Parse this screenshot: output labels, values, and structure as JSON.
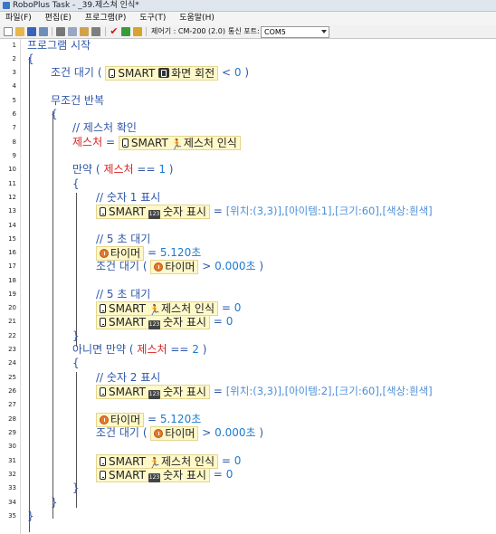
{
  "window": {
    "title": "RoboPlus Task - _39.제스쳐 인식*"
  },
  "menu": [
    "파일(F)",
    "편집(E)",
    "프로그램(P)",
    "도구(T)",
    "도움말(H)"
  ],
  "toolbar": {
    "controller_label": "제어기 : CM-200 (2.0)",
    "port_label": "통신 포트:",
    "port_value": "COM5"
  },
  "lines": [
    {
      "n": "1",
      "kw": "프로그램 시작"
    },
    {
      "n": "2",
      "kw": "{"
    },
    {
      "n": "3",
      "a": "조건 대기",
      "b": "SMART",
      "c": "화면 회전",
      "op": "<",
      "v": "0"
    },
    {
      "n": "4"
    },
    {
      "n": "5",
      "kw": "무조건 반복"
    },
    {
      "n": "6",
      "kw": "{"
    },
    {
      "n": "7",
      "comment": "// 제스처 확인"
    },
    {
      "n": "8",
      "var": "제스처",
      "b": "SMART",
      "c": "제스처 인식"
    },
    {
      "n": "9"
    },
    {
      "n": "10",
      "if": "만약",
      "var": "제스처",
      "op": "==",
      "v": "1"
    },
    {
      "n": "11",
      "kw": "{"
    },
    {
      "n": "12",
      "comment": "// 숫자 1 표시"
    },
    {
      "n": "13",
      "b": "SMART",
      "c": "숫자 표시",
      "rhs": "[위치:(3,3)],[아이템:1],[크기:60],[색상:흰색]"
    },
    {
      "n": "14"
    },
    {
      "n": "15",
      "comment": "// 5 초 대기"
    },
    {
      "n": "16",
      "timer": "타이머",
      "v": "5.120초"
    },
    {
      "n": "17",
      "a": "조건 대기",
      "timer": "타이머",
      "op": ">",
      "v": "0.000초"
    },
    {
      "n": "18"
    },
    {
      "n": "19",
      "comment": "// 5 초 대기"
    },
    {
      "n": "20",
      "b": "SMART",
      "c": "제스처 인식",
      "v": "0"
    },
    {
      "n": "21",
      "b": "SMART",
      "c": "숫자 표시",
      "v": "0"
    },
    {
      "n": "22",
      "kw": "}"
    },
    {
      "n": "23",
      "if": "아니면 만약",
      "var": "제스처",
      "op": "==",
      "v": "2"
    },
    {
      "n": "24",
      "kw": "{"
    },
    {
      "n": "25",
      "comment": "// 숫자 2 표시"
    },
    {
      "n": "26",
      "b": "SMART",
      "c": "숫자 표시",
      "rhs": "[위치:(3,3)],[아이템:2],[크기:60],[색상:흰색]"
    },
    {
      "n": "27"
    },
    {
      "n": "28",
      "timer": "타이머",
      "v": "5.120초"
    },
    {
      "n": "29",
      "a": "조건 대기",
      "timer": "타이머",
      "op": ">",
      "v": "0.000초"
    },
    {
      "n": "30"
    },
    {
      "n": "31",
      "b": "SMART",
      "c": "제스처 인식",
      "v": "0"
    },
    {
      "n": "32",
      "b": "SMART",
      "c": "숫자 표시",
      "v": "0"
    },
    {
      "n": "33",
      "kw": "}"
    },
    {
      "n": "34",
      "kw": "}"
    },
    {
      "n": "35",
      "kw": "}"
    }
  ]
}
